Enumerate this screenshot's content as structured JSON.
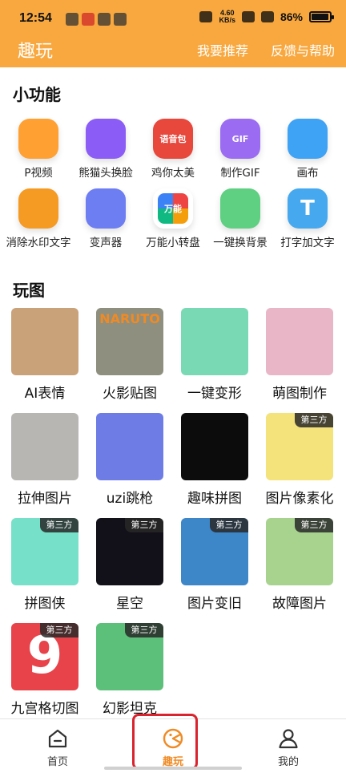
{
  "status": {
    "time": "12:54",
    "speed_top": "4.60",
    "speed_bottom": "KB/s",
    "battery": "86%",
    "battery_level": 0.86
  },
  "header": {
    "title": "趣玩",
    "recommend": "我要推荐",
    "feedback": "反馈与帮助"
  },
  "sections": {
    "tools_title": "小功能",
    "play_title": "玩图"
  },
  "tools": [
    {
      "label": "P视频",
      "icon": "video-camera-icon",
      "color": "#ffa033"
    },
    {
      "label": "熊猫头换脸",
      "icon": "panda-face-icon",
      "color": "#8b5cf6"
    },
    {
      "label": "鸡你太美",
      "icon": "voice-pack-icon",
      "color": "#e8473c",
      "icon_text": "语音包"
    },
    {
      "label": "制作GIF",
      "icon": "gif-file-icon",
      "color": "#9b6cf2",
      "icon_text": "GIF"
    },
    {
      "label": "画布",
      "icon": "palette-icon",
      "color": "#3ea2f5"
    },
    {
      "label": "消除水印文字",
      "icon": "eraser-icon",
      "color": "#f59a23"
    },
    {
      "label": "变声器",
      "icon": "microphone-icon",
      "color": "#6d7df2"
    },
    {
      "label": "万能小转盘",
      "icon": "spin-wheel-icon",
      "color": "#ffffff",
      "icon_text": "万能"
    },
    {
      "label": "一键换背景",
      "icon": "swap-background-icon",
      "color": "#5fcf82"
    },
    {
      "label": "打字加文字",
      "icon": "text-t-icon",
      "color": "#46a8ee",
      "icon_text": "T"
    }
  ],
  "play": [
    {
      "label": "AI表情",
      "thumb": "ai-face-thumbnail",
      "bg": "#c9a27a",
      "badge": ""
    },
    {
      "label": "火影贴图",
      "thumb": "naruto-thumbnail",
      "bg": "#8e8f7e",
      "badge": "",
      "thumb_text": "NARUTO"
    },
    {
      "label": "一键变形",
      "thumb": "morph-thumbnail",
      "bg": "#7ad9b5",
      "badge": ""
    },
    {
      "label": "萌图制作",
      "thumb": "cute-photo-thumbnail",
      "bg": "#e9b6c8",
      "badge": ""
    },
    {
      "label": "拉伸图片",
      "thumb": "stretch-thumbnail",
      "bg": "#b8b6b3",
      "badge": ""
    },
    {
      "label": "uzi跳枪",
      "thumb": "uzi-thumbnail",
      "bg": "#6e7de6",
      "badge": ""
    },
    {
      "label": "趣味拼图",
      "thumb": "fun-puzzle-thumbnail",
      "bg": "#0c0c0c",
      "badge": ""
    },
    {
      "label": "图片像素化",
      "thumb": "pixelate-thumbnail",
      "bg": "#f4e27a",
      "badge": "第三方"
    },
    {
      "label": "拼图侠",
      "thumb": "puzzle-hero-thumbnail",
      "bg": "#76e0c8",
      "badge": "第三方"
    },
    {
      "label": "星空",
      "thumb": "starry-sky-thumbnail",
      "bg": "#121018",
      "badge": "第三方"
    },
    {
      "label": "图片变旧",
      "thumb": "old-photo-thumbnail",
      "bg": "#3d86c7",
      "badge": "第三方"
    },
    {
      "label": "故障图片",
      "thumb": "glitch-thumbnail",
      "bg": "#a8d38f",
      "badge": "第三方"
    },
    {
      "label": "九宫格切图",
      "thumb": "nine-grid-thumbnail",
      "bg": "#e8434a",
      "badge": "第三方",
      "thumb_text": "9"
    },
    {
      "label": "幻影坦克",
      "thumb": "phantom-tank-thumbnail",
      "bg": "#5cc07a",
      "badge": "第三方"
    }
  ],
  "nav": {
    "home": "首页",
    "fun": "趣玩",
    "mine": "我的",
    "active_color": "#f08a24"
  }
}
